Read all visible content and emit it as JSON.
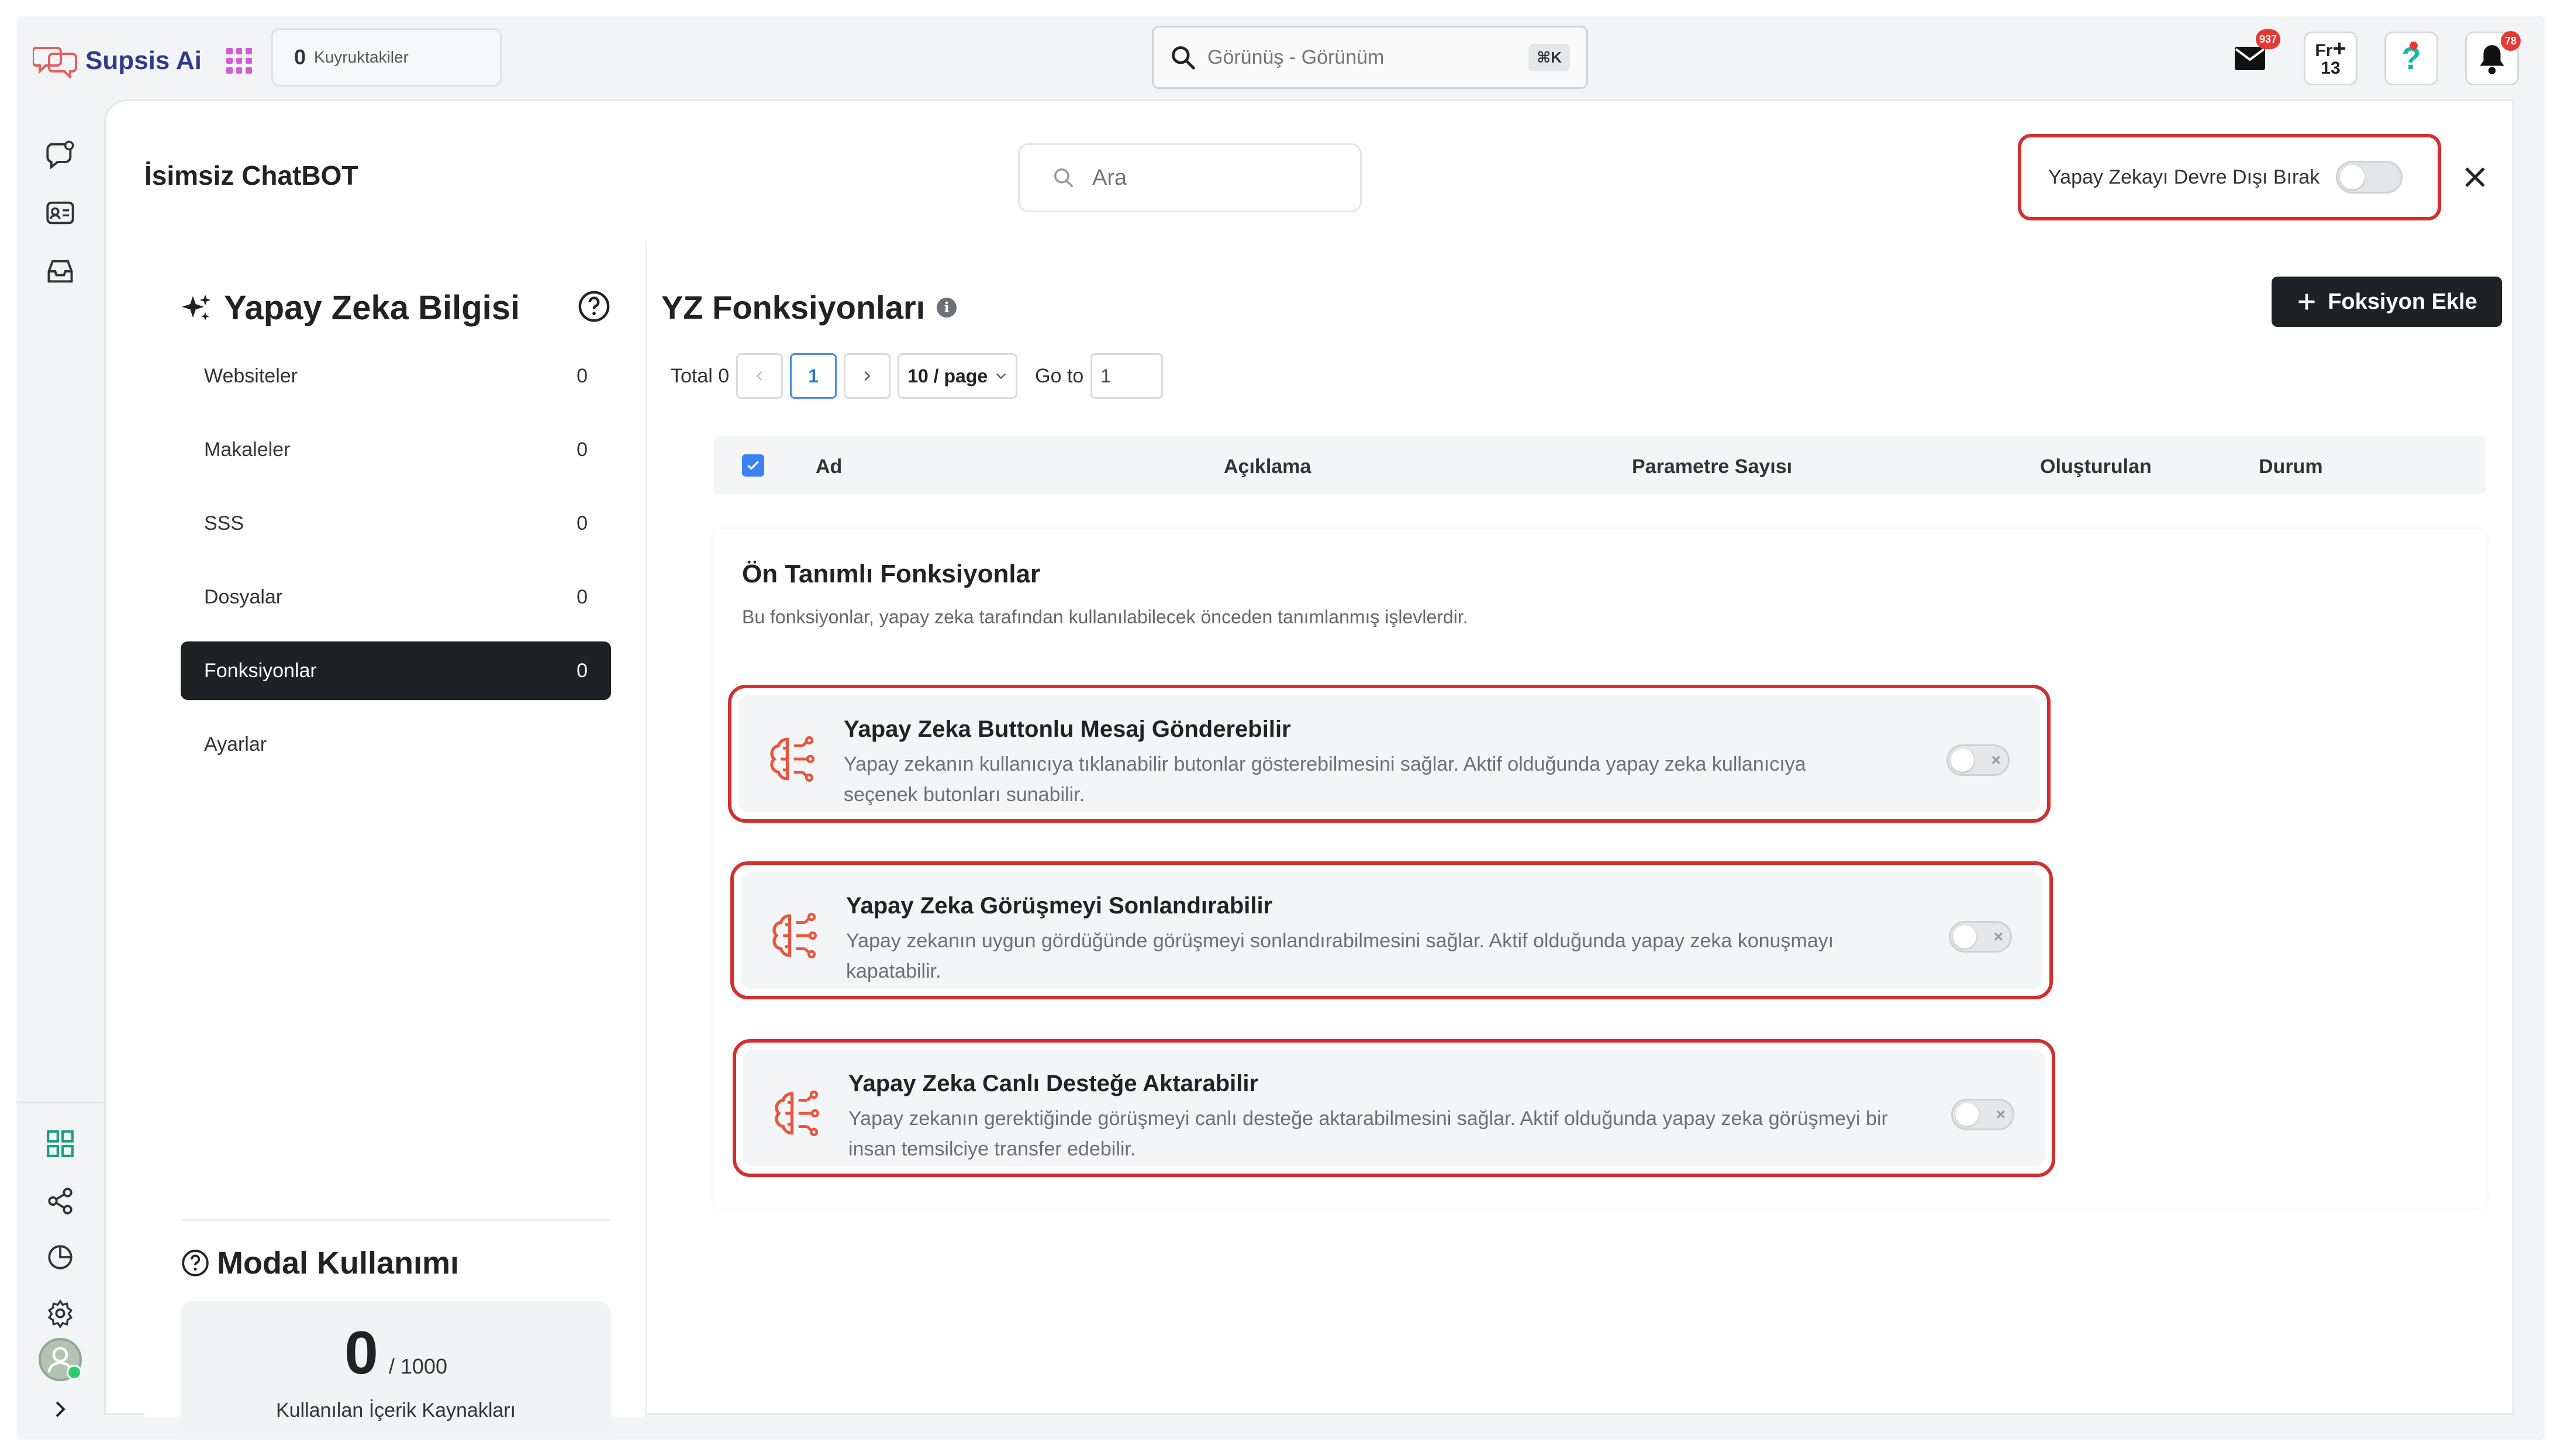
{
  "topbar": {
    "app_name": "Supsis Ai",
    "queue_count": "0",
    "queue_label": "Kuyruktakiler",
    "search_placeholder": "Görünüş - Görünüm",
    "search_shortcut": "⌘K",
    "mail_badge": "937",
    "fr_line1": "Fr",
    "fr_line2": "13",
    "bell_badge": "78"
  },
  "panel": {
    "title": "İsimsiz ChatBOT",
    "search_placeholder": "Ara",
    "disable_ai_label": "Yapay Zekayı Devre Dışı Bırak",
    "disable_ai_on": false
  },
  "knowledge": {
    "title": "Yapay Zeka Bilgisi",
    "items": [
      {
        "label": "Websiteler",
        "count": "0"
      },
      {
        "label": "Makaleler",
        "count": "0"
      },
      {
        "label": "SSS",
        "count": "0"
      },
      {
        "label": "Dosyalar",
        "count": "0"
      },
      {
        "label": "Fonksiyonlar",
        "count": "0"
      },
      {
        "label": "Ayarlar",
        "count": ""
      }
    ],
    "active_index": 4
  },
  "usage": {
    "title": "Modal Kullanımı",
    "used": "0",
    "limit": "/ 1000",
    "label": "Kullanılan İçerik Kaynakları"
  },
  "functions": {
    "title": "YZ Fonksiyonları",
    "add_button": "Foksiyon Ekle",
    "pager": {
      "total": "Total 0",
      "current_page": "1",
      "page_size": "10 / page",
      "goto_label": "Go to",
      "goto_value": "1"
    },
    "columns": [
      "Ad",
      "Açıklama",
      "Parametre Sayısı",
      "Oluşturulan",
      "Durum"
    ],
    "predefined_title": "Ön Tanımlı Fonksiyonlar",
    "predefined_subtitle": "Bu fonksiyonlar, yapay zeka tarafından kullanılabilecek önceden tanımlanmış işlevlerdir.",
    "predefined": [
      {
        "name": "Yapay Zeka Buttonlu Mesaj Gönderebilir",
        "description": "Yapay zekanın kullanıcıya tıklanabilir butonlar gösterebilmesini sağlar. Aktif olduğunda yapay zeka kullanıcıya seçenek butonları sunabilir.",
        "enabled": false
      },
      {
        "name": "Yapay Zeka Görüşmeyi Sonlandırabilir",
        "description": "Yapay zekanın uygun gördüğünde görüşmeyi sonlandırabilmesini sağlar. Aktif olduğunda yapay zeka konuşmayı kapatabilir.",
        "enabled": false
      },
      {
        "name": "Yapay Zeka Canlı Desteğe Aktarabilir",
        "description": "Yapay zekanın gerektiğinde görüşmeyi canlı desteğe aktarabilmesini sağlar. Aktif olduğunda yapay zeka görüşmeyi bir insan temsilciye transfer edebilir.",
        "enabled": false
      }
    ]
  },
  "colors": {
    "accent": "#d32f2f",
    "active_nav": "#1f2124",
    "function_icon": "#e8553f",
    "link_blue": "#3b82f6"
  }
}
